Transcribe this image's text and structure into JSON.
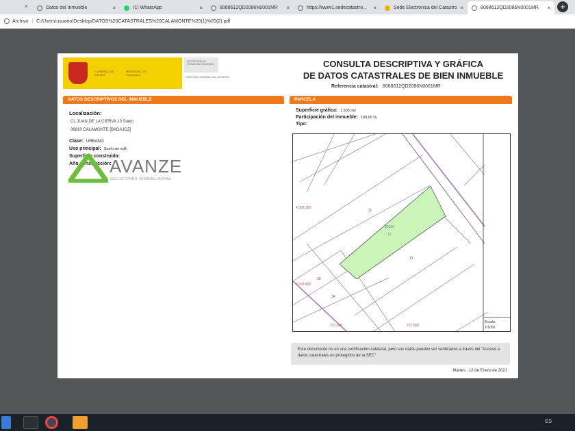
{
  "browser": {
    "tabs": [
      {
        "label": "Datos del Inmueble",
        "active": false
      },
      {
        "label": "(1) WhatsApp",
        "active": false
      },
      {
        "label": "8068612QD2086N0001MR",
        "active": false
      },
      {
        "label": "https://www1.sedecatastro...",
        "active": false
      },
      {
        "label": "Sede Electrónica del Catastro",
        "active": false
      },
      {
        "label": "8068612QD2086N0001MR",
        "active": true
      }
    ],
    "close_glyph": "×",
    "new_tab_glyph": "+",
    "address_prefix": "Archivo",
    "address": "C:/Users/usuario/Desktop/DATOS%20CATASTRALES%20CALAMONTE%20(1)%20(2).pdf"
  },
  "document": {
    "logo": {
      "gobierno": "GOBIERNO DE ESPAÑA",
      "ministerio": "MINISTERIO DE HACIENDA",
      "secretaria": "SECRETARÍA DE ESTADO DE HACIENDA",
      "direccion": "DIRECCIÓN GENERAL DEL CATASTRO"
    },
    "title_line1": "CONSULTA DESCRIPTIVA Y GRÁFICA",
    "title_line2": "DE DATOS CATASTRALES DE BIEN INMUEBLE",
    "ref_label": "Referencia catastral:",
    "ref_value": "8068612QD2086N0001MR",
    "left_section": {
      "header": "DATOS DESCRIPTIVOS DEL INMUEBLE",
      "localizacion_label": "Localización:",
      "address_line1": "CL JUAN DE LA CIERVA 13 Suelo",
      "address_line2": "06810 CALAMONTE [BADAJOZ]",
      "clase_label": "Clase:",
      "clase_value": "URBANO",
      "uso_label": "Uso principal:",
      "uso_value": "Suelo sin edif.",
      "superficie_label": "Superficie construida:",
      "ano_label": "Año construcción:"
    },
    "right_section": {
      "header": "PARCELA",
      "superficie_label": "Superficie gráfica:",
      "superficie_value": "1.503 m2",
      "participacion_label": "Participación del inmueble:",
      "participacion_value": "100,00 %",
      "tipo_label": "Tipo:"
    },
    "map": {
      "parcel_color": "#c9f5b8",
      "labels": {
        "p11": "11",
        "p13": "13",
        "p35": "35",
        "p34": "34",
        "parcel": "80686",
        "parcel_num": "12",
        "y1": "4.306.350",
        "y2": "4.306.800",
        "x1": "727.900",
        "x2": "727.950"
      },
      "scale_label": "Escala:",
      "scale_value": "1/1000"
    },
    "note": "Este documento no es una certificación catastral, pero sus datos pueden ser verificados a través del \"Acceso a datos catastrales no protegidos de la SEC\"",
    "date": "Martes , 12 de Enero de 2021"
  },
  "watermark": {
    "brand": "AVANZE",
    "subtitle": "SOLUCIONES INMOBILIARIAS",
    "color": "#6bbf3a"
  },
  "taskbar": {
    "language": "ES"
  }
}
